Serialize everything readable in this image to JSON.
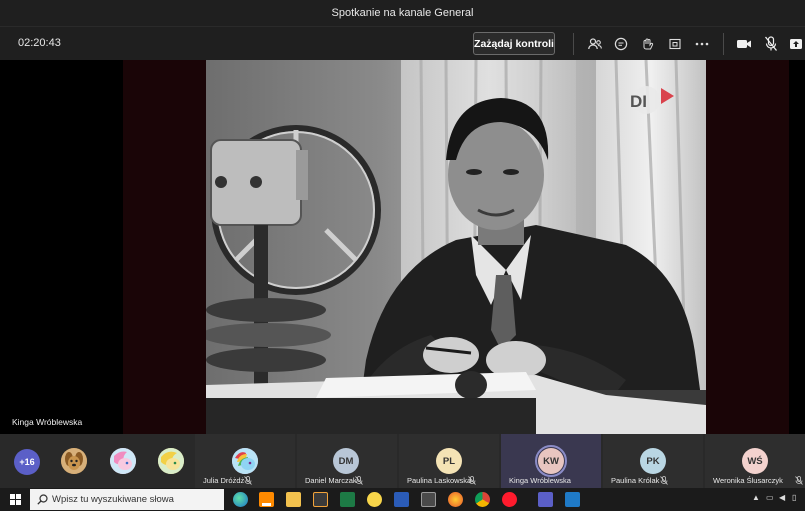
{
  "window": {
    "title": "Spotkanie na kanale General"
  },
  "toolbar": {
    "timer": "02:20:43",
    "request_control_label": "Zażądaj kontroli",
    "icons": [
      "participants-icon",
      "chat-icon",
      "reactions-icon",
      "share-icon",
      "more-icon",
      "camera-icon",
      "mic-off-icon",
      "share-tray-icon"
    ]
  },
  "stage": {
    "speaker_name": "Kinga Wróblewska",
    "video_overlay_text": "DI"
  },
  "participants": {
    "overflow_count": "+16",
    "tiles": [
      {
        "name": "Julia Dróżdż",
        "initials": "",
        "muted": true
      },
      {
        "name": "Daniel Marczak",
        "initials": "DM",
        "muted": true
      },
      {
        "name": "Paulina Laskowska",
        "initials": "PL",
        "muted": true
      },
      {
        "name": "Kinga Wróblewska",
        "initials": "KW",
        "muted": false
      },
      {
        "name": "Paulina Królak",
        "initials": "PK",
        "muted": true
      },
      {
        "name": "Weronika Ślusarczyk",
        "initials": "WŚ",
        "muted": true
      }
    ],
    "colors": {
      "overflow": "#5b5fc7",
      "dm": "#b8c6d6",
      "pl": "#f4e3b5",
      "kw": "#e8c5c0",
      "pk": "#b9d6e3",
      "ws": "#f3d2ce"
    }
  },
  "taskbar": {
    "search_placeholder": "Wpisz tu wyszukiwane słowa",
    "apps": [
      "edge-icon",
      "vlc-icon",
      "file-explorer-icon",
      "media-player-icon",
      "excel-icon",
      "sticky-notes-icon",
      "word-icon",
      "calculator-icon",
      "firefox-icon",
      "chrome-icon",
      "opera-icon",
      "teams-icon",
      "photos-icon"
    ]
  }
}
